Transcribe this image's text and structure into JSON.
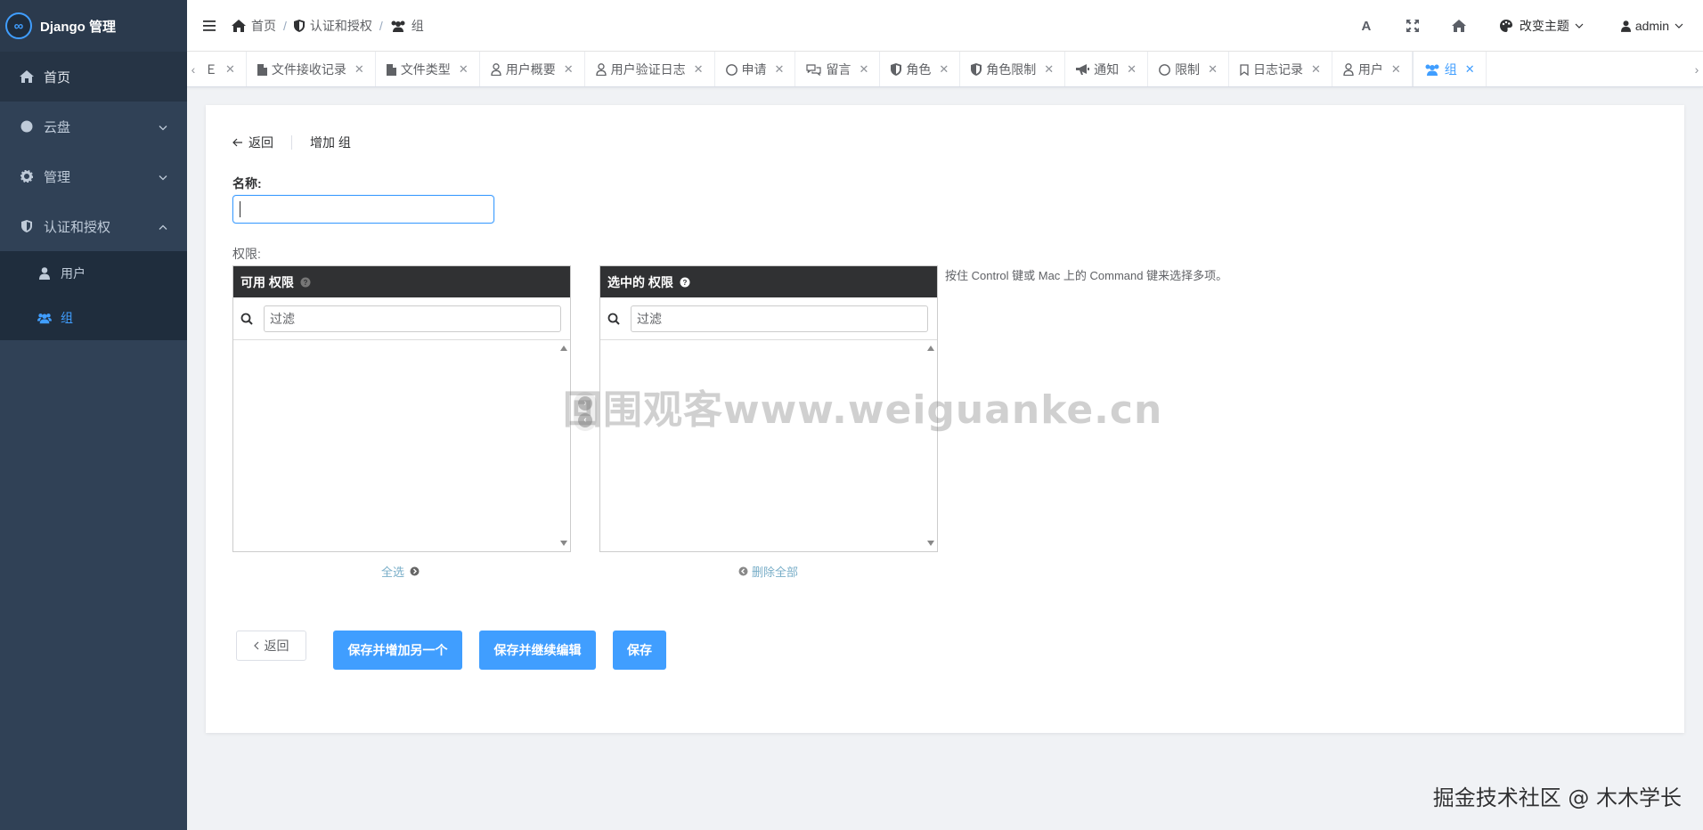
{
  "app": {
    "title": "Django 管理",
    "logo_glyph": "∞",
    "accent": "#409eff",
    "sidebar_bg": "#304156"
  },
  "sidebar": {
    "items": [
      {
        "label": "首页",
        "icon": "home-icon"
      },
      {
        "label": "云盘",
        "icon": "circle-icon",
        "expandable": true
      },
      {
        "label": "管理",
        "icon": "gear-icon",
        "expandable": true
      },
      {
        "label": "认证和授权",
        "icon": "shield-icon",
        "expanded": true
      }
    ],
    "sub_items": [
      {
        "label": "用户",
        "icon": "user-icon"
      },
      {
        "label": "组",
        "icon": "users-icon",
        "active": true
      }
    ]
  },
  "navbar": {
    "breadcrumb": [
      {
        "label": "首页",
        "icon": "home-icon"
      },
      {
        "label": "认证和授权",
        "icon": "shield-icon"
      },
      {
        "label": "组",
        "icon": "users-icon"
      }
    ],
    "separator": "/",
    "font_icon_label": "A",
    "theme_label": "改变主题",
    "user_label": "admin"
  },
  "tabs": [
    {
      "label": "",
      "icon": "",
      "partial_text": "Ｅ"
    },
    {
      "label": "文件接收记录",
      "icon": "file-icon"
    },
    {
      "label": "文件类型",
      "icon": "file-icon"
    },
    {
      "label": "用户概要",
      "icon": "user-outline-icon"
    },
    {
      "label": "用户验证日志",
      "icon": "user-outline-icon"
    },
    {
      "label": "申请",
      "icon": "circle-outline-icon"
    },
    {
      "label": "留言",
      "icon": "comments-icon"
    },
    {
      "label": "角色",
      "icon": "shield-icon"
    },
    {
      "label": "角色限制",
      "icon": "shield-icon"
    },
    {
      "label": "通知",
      "icon": "bullhorn-icon"
    },
    {
      "label": "限制",
      "icon": "circle-outline-icon"
    },
    {
      "label": "日志记录",
      "icon": "bookmark-icon"
    },
    {
      "label": "用户",
      "icon": "user-outline-icon"
    },
    {
      "label": "组",
      "icon": "users-icon",
      "active": true
    }
  ],
  "form": {
    "back_label": "返回",
    "page_title": "增加 组",
    "name_label": "名称:",
    "name_value": "",
    "permissions_label": "权限:",
    "available": {
      "title": "可用 权限",
      "filter_placeholder": "过滤",
      "choose_all": "全选"
    },
    "chosen": {
      "title": "选中的 权限",
      "filter_placeholder": "过滤",
      "clear_all": "删除全部"
    },
    "help_text": "按住 Control 键或 Mac 上的 Command 键来选择多项。",
    "buttons": {
      "back": "返回",
      "save_add_another": "保存并增加另一个",
      "save_continue": "保存并继续编辑",
      "save": "保存"
    }
  },
  "watermarks": {
    "center": "回围观客www.weiguanke.cn",
    "corner": "掘金技术社区 @ 木木学长"
  }
}
